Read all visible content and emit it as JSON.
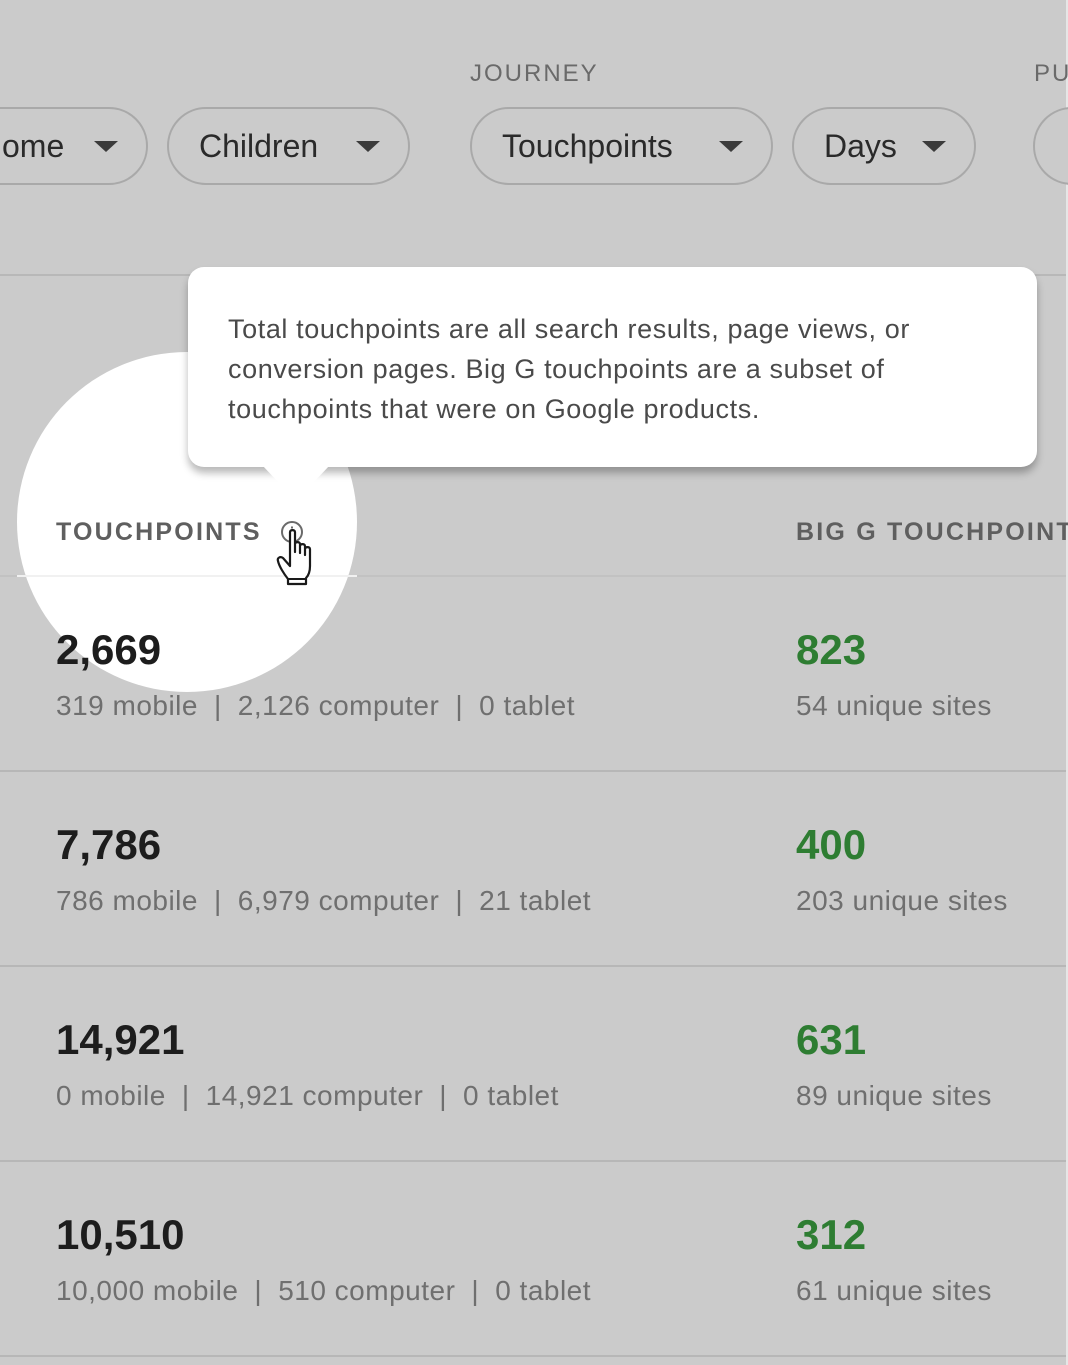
{
  "filters": {
    "group_labels": {
      "journey": "JOURNEY",
      "next_partial": "PU"
    },
    "chips": [
      {
        "label": "ome"
      },
      {
        "label": "Children"
      },
      {
        "label": "Touchpoints"
      },
      {
        "label": "Days"
      }
    ]
  },
  "tooltip": {
    "text": "Total touchpoints are all search results, page views, or conversion pages. Big G touchpoints are a subset of touchpoints that were on Google products."
  },
  "columns": {
    "touchpoints": "TOUCHPOINTS",
    "big_g": "BIG G TOUCHPOINT"
  },
  "rows": [
    {
      "total": "2,669",
      "mobile": "319 mobile",
      "computer": "2,126 computer",
      "tablet": "0 tablet",
      "big_g": "823",
      "sites": "54 unique sites"
    },
    {
      "total": "7,786",
      "mobile": "786 mobile",
      "computer": "6,979 computer",
      "tablet": "21 tablet",
      "big_g": "400",
      "sites": "203 unique sites"
    },
    {
      "total": "14,921",
      "mobile": "0 mobile",
      "computer": "14,921 computer",
      "tablet": "0 tablet",
      "big_g": "631",
      "sites": "89 unique sites"
    },
    {
      "total": "10,510",
      "mobile": "10,000 mobile",
      "computer": "510 computer",
      "tablet": "0 tablet",
      "big_g": "312",
      "sites": "61 unique sites"
    }
  ],
  "separator": "|",
  "colors": {
    "background": "#cbcbcb",
    "big_g_green": "#2e7d32"
  },
  "icons": {
    "info": "info-icon",
    "cursor": "hand-cursor-icon",
    "dropdown": "caret-down-icon"
  }
}
